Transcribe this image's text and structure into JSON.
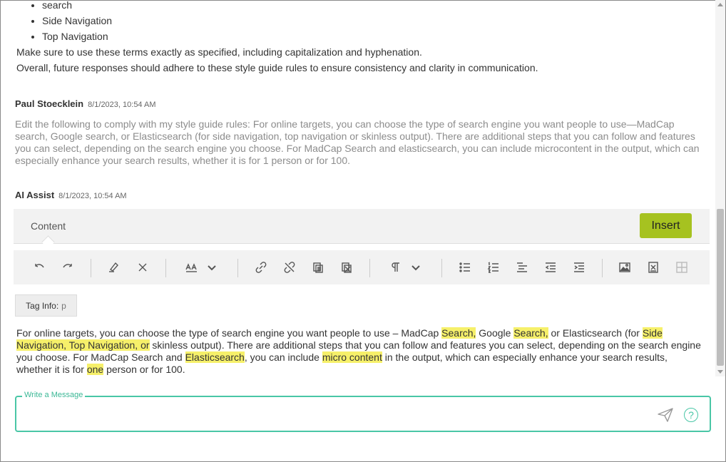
{
  "prior_message": {
    "bullets": [
      "search",
      "Side Navigation",
      "Top Navigation"
    ],
    "line1": "Make sure to use these terms exactly as specified, including capitalization and hyphenation.",
    "line2": "Overall, future responses should adhere to these style guide rules to ensure consistency and clarity in communication."
  },
  "user_message": {
    "author": "Paul Stoecklein",
    "timestamp": "8/1/2023, 10:54 AM",
    "text": "Edit the following to comply with my style guide rules: For online targets, you can choose the type of search engine you want people to use—MadCap search, Google search, or Elasticsearch (for side navigation, top navigation or skinless output). There are additional steps that you can follow and features you can select, depending on the search engine you choose. For MadCap Search and elasticsearch, you can include microcontent in the output, which can especially enhance your search results, whether it is for 1 person or for 100."
  },
  "ai_message": {
    "author": "AI Assist",
    "timestamp": "8/1/2023, 10:54 AM",
    "tab_label": "Content",
    "insert_label": "Insert",
    "tag_info_label": "Tag Info:",
    "tag_info_value": "p",
    "edited": {
      "s1": "For online targets, you can choose the type of search engine you want people to use – MadCap ",
      "h1": "Search,",
      "s2": " Google ",
      "h2": "Search,",
      "s3": " or Elasticsearch (for ",
      "h3": "Side Navigation, Top Navigation, or",
      "s4": " skinless output). There are additional steps that you can follow and features you can select, depending on the search engine you choose. For MadCap Search and ",
      "h4": "Elasticsearch",
      "s5": ", you can include ",
      "h5": "micro content",
      "s6": " in the output, which can especially enhance your search results, whether it is for ",
      "h6": "one",
      "s7": " person or for 100."
    }
  },
  "composer": {
    "label": "Write a Message",
    "value": "",
    "help_glyph": "?"
  },
  "colors": {
    "accent": "#49c6a6",
    "insert": "#a6c220",
    "highlight": "#f6f06a"
  }
}
